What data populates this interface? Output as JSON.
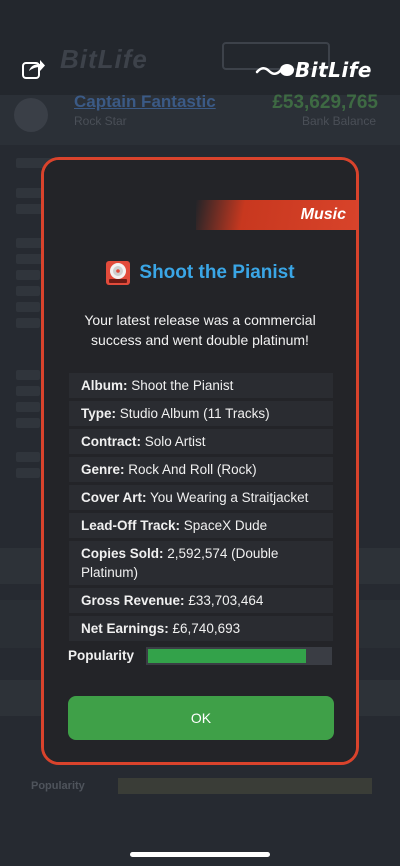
{
  "background": {
    "logo_text": "BitLife",
    "profile_name": "Captain Fantastic",
    "profile_subtitle": "Rock Star",
    "profile_money": "£53,629,765",
    "profile_money_label": "Bank Balance",
    "bottom_popularity_label": "Popularity"
  },
  "header": {
    "share_icon": "share-icon",
    "brand_text": "BitLife"
  },
  "modal": {
    "category": "Music",
    "title": "Shoot the Pianist",
    "title_icon": "album-record-icon",
    "description": "Your latest release was a commercial success and went double platinum!",
    "details": [
      {
        "label": "Album:",
        "value": "Shoot the Pianist"
      },
      {
        "label": "Type:",
        "value": "Studio Album (11 Tracks)"
      },
      {
        "label": "Contract:",
        "value": "Solo Artist"
      },
      {
        "label": "Genre:",
        "value": "Rock And Roll (Rock)"
      },
      {
        "label": "Cover Art:",
        "value": "You Wearing a Straitjacket"
      },
      {
        "label": "Lead-Off Track:",
        "value": "SpaceX Dude"
      },
      {
        "label": "Copies Sold:",
        "value": "2,592,574 (Double Platinum)"
      },
      {
        "label": "Gross Revenue:",
        "value": "£33,703,464"
      },
      {
        "label": "Net Earnings:",
        "value": "£6,740,693"
      }
    ],
    "popularity_label": "Popularity",
    "popularity_fraction": 0.87,
    "ok_label": "OK"
  },
  "colors": {
    "accent_red": "#d9432c",
    "title_blue": "#3aa6e6",
    "ok_green": "#3fa048",
    "bar_green": "#33a24a"
  }
}
